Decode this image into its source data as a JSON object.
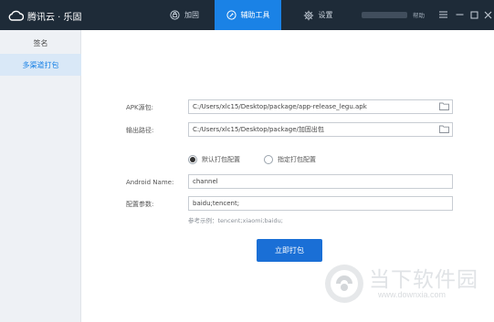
{
  "app": {
    "brand": "腾讯云 · 乐固",
    "colors": {
      "topbar": "#1e2b38",
      "accent": "#1a82e6",
      "button": "#1a6fd6",
      "sidebar": "#eef1f5"
    }
  },
  "nav": {
    "tabs": [
      {
        "label": "加固",
        "icon": "shield-icon"
      },
      {
        "label": "辅助工具",
        "icon": "tools-icon",
        "active": true
      },
      {
        "label": "设置",
        "icon": "gear-icon"
      }
    ],
    "help": "帮助"
  },
  "sidebar": {
    "items": [
      {
        "label": "签名"
      },
      {
        "label": "多渠道打包",
        "active": true
      }
    ]
  },
  "form": {
    "apk_label": "APK源包:",
    "apk_value": "C:/Users/xlc15/Desktop/package/app-release_legu.apk",
    "output_label": "输出路径:",
    "output_value": "C:/Users/xlc15/Desktop/package/加固出包",
    "radio_default": "默认打包配置",
    "radio_custom": "指定打包配置",
    "selected_mode": "默认打包配置",
    "android_name_label": "Android Name:",
    "android_name_value": "channel",
    "config_label": "配置参数:",
    "config_value": "baidu;tencent;",
    "hint": "参考示例：tencent;xiaomi;baidu;",
    "submit": "立即打包"
  },
  "watermark": {
    "text": "当下软件园",
    "url": "www.downxia.com"
  }
}
